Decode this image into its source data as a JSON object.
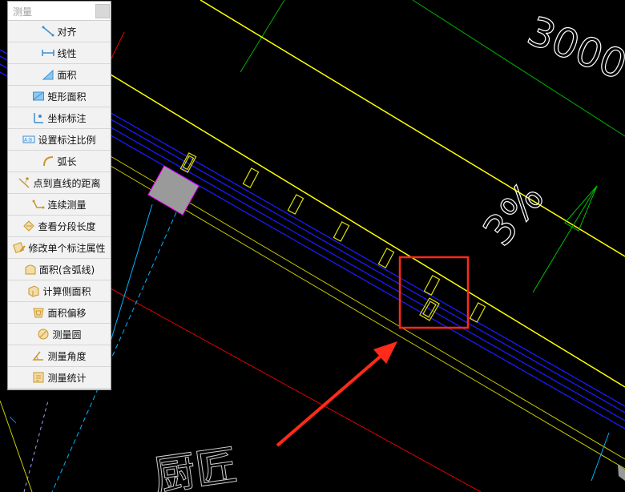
{
  "panel": {
    "title": "测量",
    "items": [
      {
        "label": "对齐",
        "icon": "aligned-dimension-icon"
      },
      {
        "label": "线性",
        "icon": "linear-dimension-icon"
      },
      {
        "label": "面积",
        "icon": "area-icon"
      },
      {
        "label": "矩形面积",
        "icon": "rectangle-area-icon"
      },
      {
        "label": "坐标标注",
        "icon": "coordinate-icon"
      },
      {
        "label": "设置标注比例",
        "icon": "scale-icon"
      },
      {
        "label": "弧长",
        "icon": "arc-length-icon"
      },
      {
        "label": "点到直线的距离",
        "icon": "point-to-line-icon"
      },
      {
        "label": "连续测量",
        "icon": "continuous-measure-icon"
      },
      {
        "label": "查看分段长度",
        "icon": "segment-length-icon"
      },
      {
        "label": "修改单个标注属性",
        "icon": "edit-dimension-icon"
      },
      {
        "label": "面积(含弧线)",
        "icon": "arc-area-icon"
      },
      {
        "label": "计算侧面积",
        "icon": "side-area-icon"
      },
      {
        "label": "面积偏移",
        "icon": "area-offset-icon"
      },
      {
        "label": "测量圆",
        "icon": "measure-circle-icon"
      },
      {
        "label": "测量角度",
        "icon": "measure-angle-icon"
      },
      {
        "label": "测量统计",
        "icon": "measure-stats-icon"
      }
    ]
  },
  "drawing": {
    "dimension_text": "3000",
    "slope_text": "3%",
    "bottom_text": "厨匠"
  },
  "colors": {
    "background": "#000000",
    "yellow": "#ffff00",
    "blue": "#1010ff",
    "green": "#00cc00",
    "cyan": "#00c0ff",
    "red": "#ff0000",
    "highlight": "#ff2a1a",
    "white": "#ffffff"
  }
}
